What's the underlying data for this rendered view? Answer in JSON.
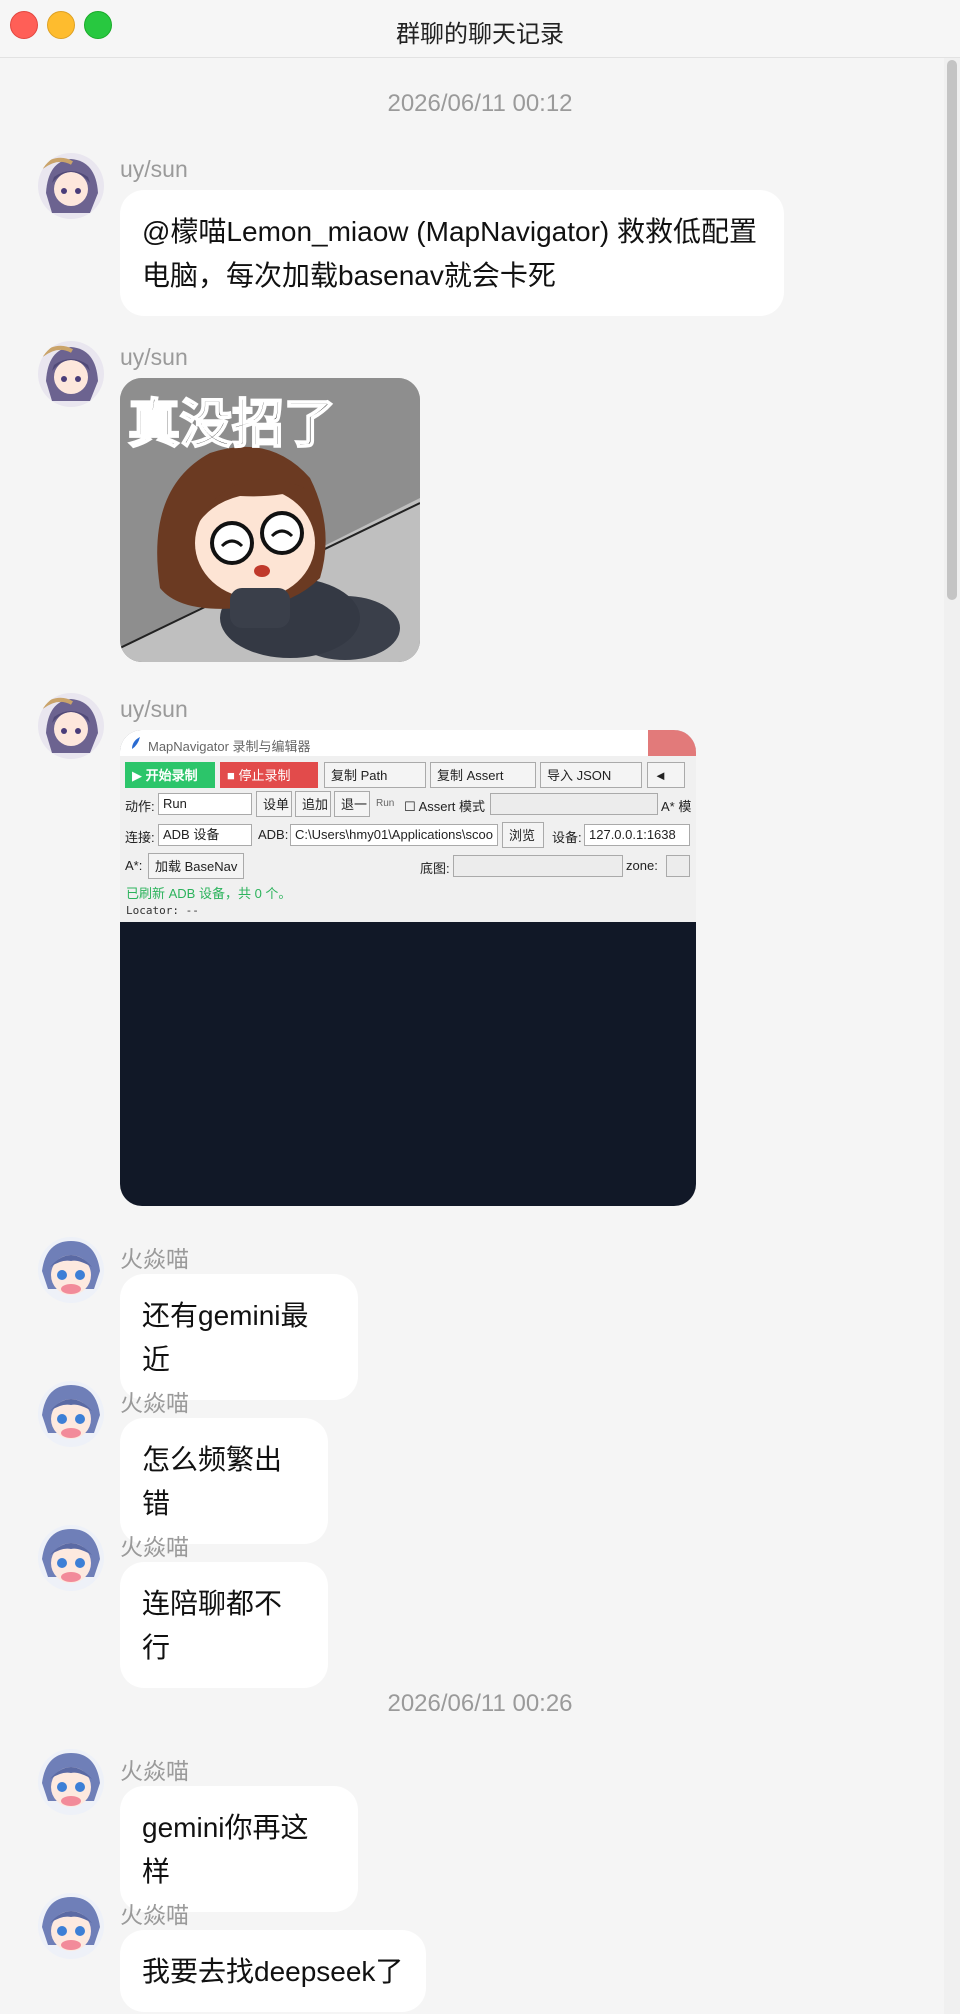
{
  "window": {
    "title": "群聊的聊天记录"
  },
  "timestamps": [
    "2026/06/11 00:12",
    "2026/06/11 00:26"
  ],
  "senders": {
    "uy": "uy/sun",
    "fire": "火焱喵"
  },
  "messages": {
    "m1": "@檬喵Lemon_miaow (MapNavigator) 救救低配置电脑，每次加载basenav就会卡死",
    "m4": "还有gemini最近",
    "m5": "怎么频繁出错",
    "m6": "连陪聊都不行",
    "m7": "gemini你再这样",
    "m8": "我要去找deepseek了"
  },
  "sticker": {
    "text": "真没招了"
  },
  "screenshot": {
    "title": "MapNavigator 录制与编辑器",
    "start_label": "▶ 开始录制",
    "stop_label": "■ 停止录制",
    "copy_path": "复制 Path",
    "copy_assert": "复制 Assert",
    "import_json": "导入 JSON",
    "arrow": "◄",
    "action_label": "动作:",
    "action_value": "Run",
    "set_label": "设单",
    "add_label": "追加",
    "back_label": "退一",
    "run_small": "Run",
    "assert_mode": "Assert 模式",
    "astar_mode": "A* 模",
    "conn_label": "连接:",
    "conn_value": "ADB 设备",
    "adb_label": "ADB:",
    "adb_path": "C:\\Users\\hmy01\\Applications\\scoo",
    "browse": "浏览",
    "device_label": "设备:",
    "device_value": "127.0.0.1:1638",
    "astar_label": "A*:",
    "load_basenav": "加载 BaseNav",
    "base_map": "底图:",
    "zone": "zone:",
    "status": "已刷新 ADB 设备，共 0 个。",
    "locator": "Locator: --"
  },
  "colors": {
    "background": "#f5f5f5",
    "bubble": "#ffffff",
    "meta": "#9a9a9a"
  }
}
